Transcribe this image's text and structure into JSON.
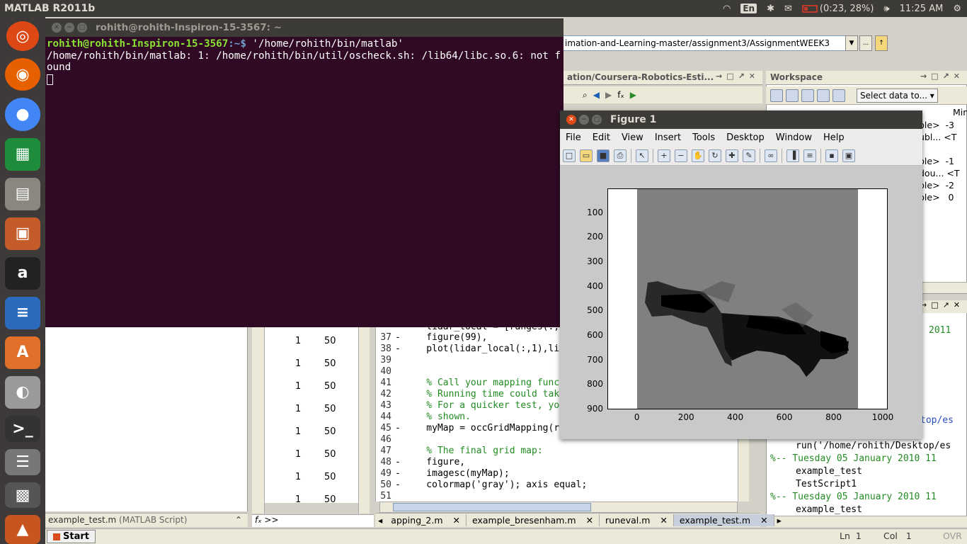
{
  "topbar": {
    "app_title": "MATLAB  R2011b",
    "lang": "En",
    "battery": "(0:23, 28%)",
    "clock": "11:25 AM"
  },
  "launcher": {
    "items": [
      "ubuntu-icon",
      "firefox-icon",
      "chrome-icon",
      "spreadsheet-icon",
      "files-icon",
      "presentation-icon",
      "amazon-icon",
      "writer-icon",
      "software-center-icon",
      "app-icon",
      "terminal-icon",
      "stack-icon",
      "clapper-icon",
      "matlab-icon",
      "trash-icon"
    ]
  },
  "terminal": {
    "title": "rohith@rohith-Inspiron-15-3567: ~",
    "prompt_user": "rohith@rohith-Inspiron-15-3567",
    "prompt_path": ":~$",
    "command": " '/home/rohith/bin/matlab'",
    "output": "/home/rohith/bin/matlab: 1: /home/rohith/bin/util/oscheck.sh: /lib64/libc.so.6: not found"
  },
  "matlab": {
    "current_folder": "imation-and-Learning-master/assignment3/AssignmentWEEK3",
    "editor_panel_title": "ation/Coursera-Robotics-Esti...",
    "workspace_title": "Workspace",
    "select_data": "Select data to...",
    "ws_min_header": "Min",
    "workspace_rows": [
      {
        "value": "ble>",
        "min": "-3"
      },
      {
        "value": "ubl...",
        "min": "<T"
      },
      {
        "value": "ble>",
        "min": "-1"
      },
      {
        "value": "dou...",
        "min": "<T"
      },
      {
        "value": "ble>",
        "min": "-2"
      },
      {
        "value": "ble>",
        "min": "0"
      }
    ],
    "history": [
      {
        "text": "2011",
        "style": "green"
      },
      {
        "text": "top/es",
        "style": "plain"
      },
      {
        "text": "run('/home/rohith/Desktop/es",
        "style": "plain"
      },
      {
        "text": "%-- Tuesday 05 January 2010 11",
        "style": "green"
      },
      {
        "text": "example_test",
        "style": "plain"
      },
      {
        "text": "TestScript1",
        "style": "plain"
      },
      {
        "text": "%-- Tuesday 05 January 2010 11",
        "style": "green"
      },
      {
        "text": "example_test",
        "style": "plain"
      }
    ],
    "left_status": "example_test.m",
    "left_status_type": "(MATLAB Script)",
    "var_rows": [
      {
        "a": "1",
        "b": "50"
      },
      {
        "a": "1",
        "b": "50"
      },
      {
        "a": "1",
        "b": "50"
      },
      {
        "a": "1",
        "b": "50"
      },
      {
        "a": "1",
        "b": "50"
      },
      {
        "a": "1",
        "b": "50"
      },
      {
        "a": "1",
        "b": "50"
      },
      {
        "a": "1",
        "b": "50"
      }
    ],
    "command_prompt": ">>",
    "editor_lines": [
      {
        "num": "",
        "mark": "",
        "code": "    lidar_local = [ranges(:,"
      },
      {
        "num": "37",
        "mark": "-",
        "code": "    figure(99),"
      },
      {
        "num": "38",
        "mark": "-",
        "code": "    plot(lidar_local(:,1),lid"
      },
      {
        "num": "39",
        "mark": "",
        "code": ""
      },
      {
        "num": "40",
        "mark": "",
        "code": ""
      },
      {
        "num": "41",
        "mark": "",
        "code": "    % Call your mapping funct",
        "cls": "cmt"
      },
      {
        "num": "42",
        "mark": "",
        "code": "    % Running time could take",
        "cls": "cmt"
      },
      {
        "num": "43",
        "mark": "",
        "code": "    % For a quicker test, you",
        "cls": "cmt"
      },
      {
        "num": "44",
        "mark": "",
        "code": "    % shown.",
        "cls": "cmt"
      },
      {
        "num": "45",
        "mark": "-",
        "code": "    myMap = occGridMapping(ra"
      },
      {
        "num": "46",
        "mark": "",
        "code": ""
      },
      {
        "num": "47",
        "mark": "",
        "code": "    % The final grid map:",
        "cls": "cmt"
      },
      {
        "num": "48",
        "mark": "-",
        "code": "    figure,"
      },
      {
        "num": "49",
        "mark": "-",
        "code": "    imagesc(myMap);"
      },
      {
        "num": "50",
        "mark": "-",
        "code": "    colormap('gray'); axis equal;"
      },
      {
        "num": "51",
        "mark": "",
        "code": ""
      }
    ],
    "editor_tabs": [
      "apping_2.m",
      "example_bresenham.m",
      "runeval.m",
      "example_test.m"
    ],
    "start_label": "Start",
    "status_ln_label": "Ln",
    "status_ln": "1",
    "status_col_label": "Col",
    "status_col": "1",
    "status_ovr": "OVR"
  },
  "figure": {
    "title": "Figure 1",
    "menu": [
      "File",
      "Edit",
      "View",
      "Insert",
      "Tools",
      "Desktop",
      "Window",
      "Help"
    ],
    "yticks": [
      "100",
      "200",
      "300",
      "400",
      "500",
      "600",
      "700",
      "800",
      "900"
    ],
    "xticks": [
      "0",
      "200",
      "400",
      "600",
      "800",
      "1000"
    ]
  },
  "chart_data": {
    "type": "heatmap",
    "colormap": "gray",
    "x_ticks": [
      0,
      200,
      400,
      600,
      800,
      1000
    ],
    "y_ticks": [
      100,
      200,
      300,
      400,
      500,
      600,
      700,
      800,
      900
    ],
    "xlim": [
      -120,
      1020
    ],
    "ylim": [
      0,
      900
    ],
    "background_value": "gray",
    "description_values": []
  }
}
